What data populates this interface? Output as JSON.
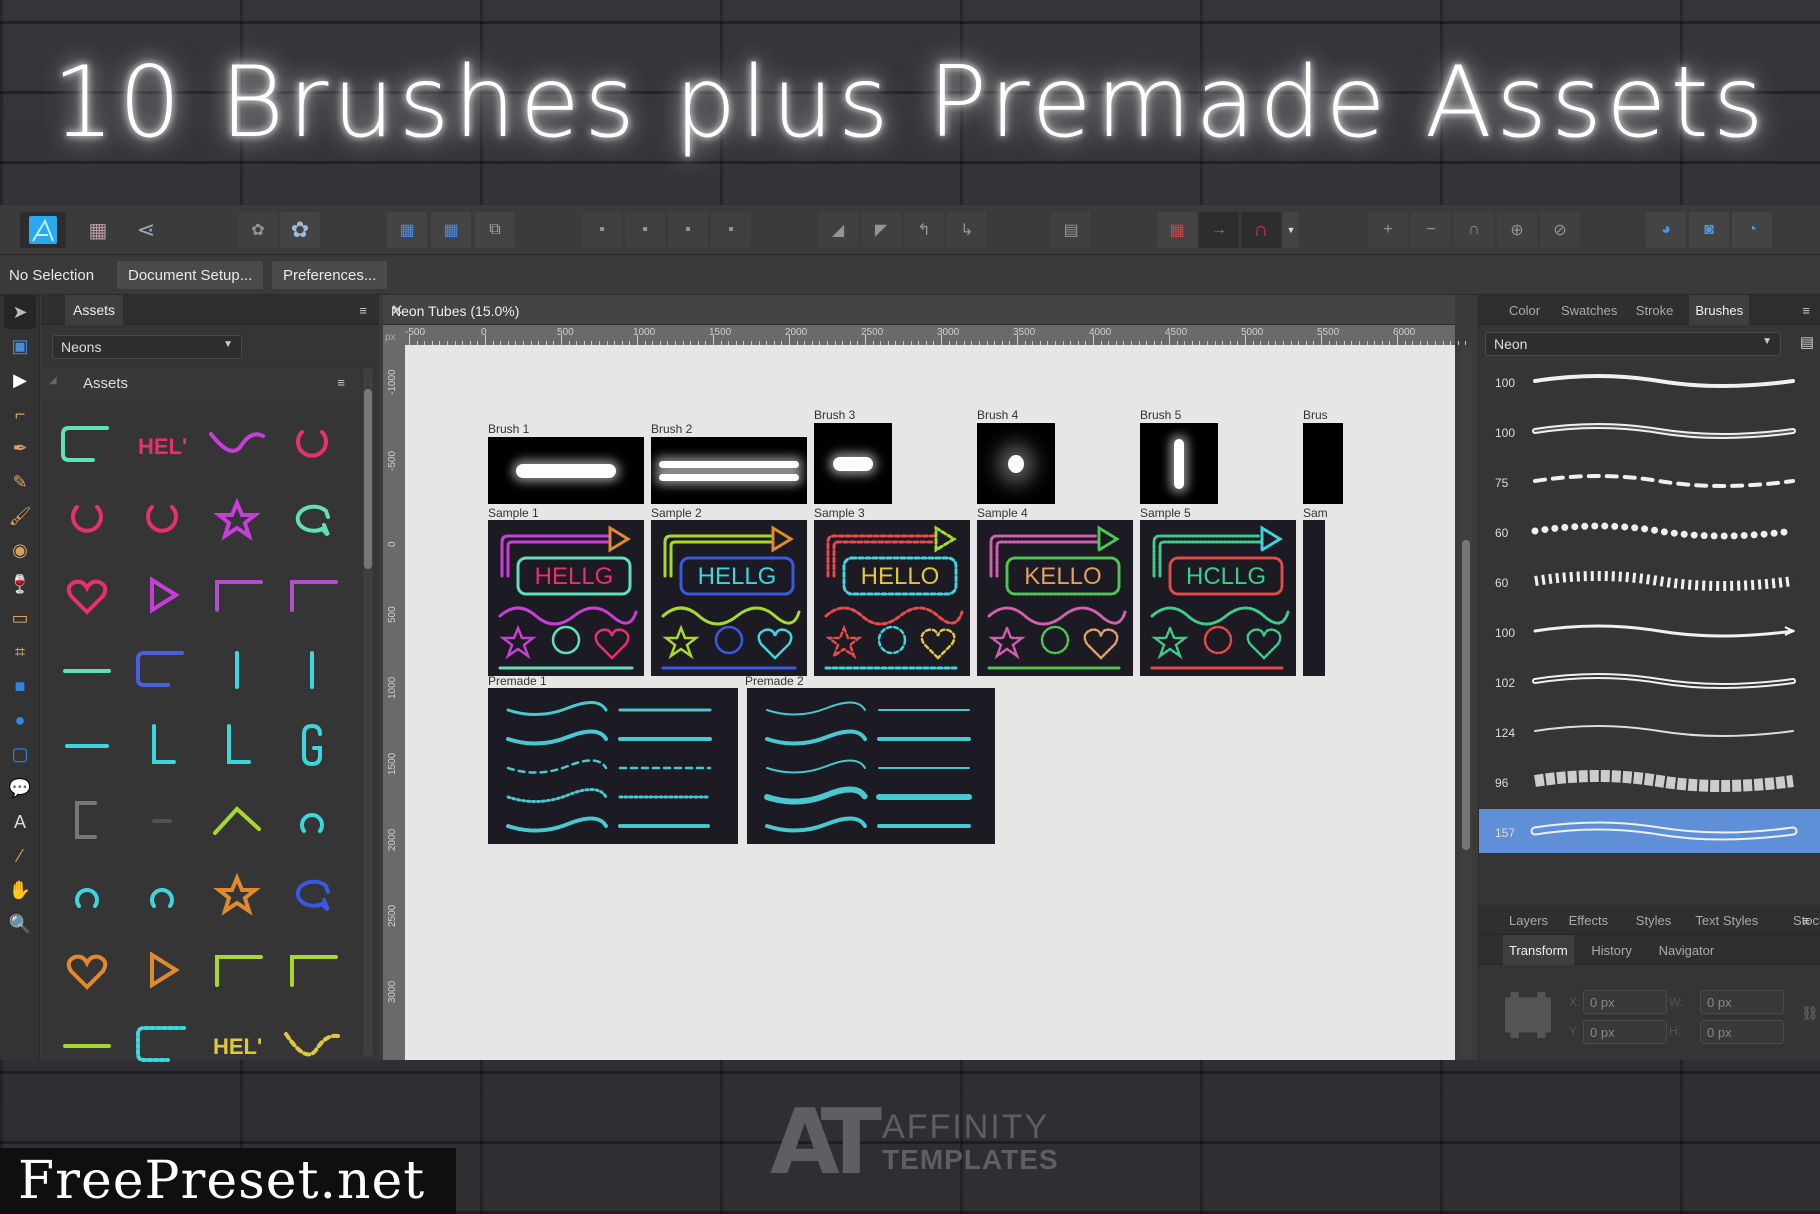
{
  "banner": {
    "title": "10 Brushes plus Premade Assets"
  },
  "toolbar": {
    "persona_icon": "affinity-designer-icon",
    "buttons": [
      "grid-persona-icon",
      "share-icon",
      "boolean-disabled-icon",
      "no-fill-icon",
      "select-grid-icon",
      "select-grid-alt-icon",
      "transform-origin-icon",
      "arrange-back-icon",
      "arrange-backward-icon",
      "arrange-forward-icon",
      "arrange-front-icon",
      "align-icon",
      "flip-h-icon",
      "flip-v-icon",
      "rotate-left-icon",
      "rotate-right-icon",
      "insert-icon",
      "snapping-grid-icon",
      "snapping-arrow-icon",
      "snapping-magnet-icon",
      "add-icon",
      "subtract-icon",
      "intersect-icon",
      "xor-icon",
      "divide-icon",
      "boolean-add-icon",
      "boolean-subtract-icon",
      "boolean-intersect-icon"
    ]
  },
  "context": {
    "selection": "No Selection",
    "document_setup": "Document Setup...",
    "preferences": "Preferences..."
  },
  "tools": [
    "move-tool",
    "artboard-tool",
    "node-tool",
    "corner-tool",
    "pen-tool",
    "pencil-tool",
    "vector-brush-tool",
    "fill-tool",
    "transparency-tool",
    "place-image-tool",
    "crop-tool",
    "rectangle-tool",
    "ellipse-tool",
    "rounded-rect-tool",
    "callout-tool",
    "text-tool",
    "color-picker-tool",
    "view-tool",
    "zoom-tool"
  ],
  "assets_panel": {
    "tab": "Assets",
    "category": "Neons",
    "subcategory": "Assets",
    "items": [
      {
        "shape": "bracket",
        "color": "#5fe0b8"
      },
      {
        "shape": "HEL'",
        "color": "#e8306e"
      },
      {
        "shape": "wave",
        "color": "#c83ed8"
      },
      {
        "shape": "ring",
        "color": "#e8306e"
      },
      {
        "shape": "ring",
        "color": "#e8306e"
      },
      {
        "shape": "ring",
        "color": "#e8306e"
      },
      {
        "shape": "star",
        "color": "#c83ed8"
      },
      {
        "shape": "bubble",
        "color": "#5fe0b8"
      },
      {
        "shape": "heart",
        "color": "#e8306e"
      },
      {
        "shape": "triangle",
        "color": "#c83ed8"
      },
      {
        "shape": "corner",
        "color": "#b24fc8"
      },
      {
        "shape": "corner",
        "color": "#b24fc8"
      },
      {
        "shape": "bar",
        "color": "#5fe0b8"
      },
      {
        "shape": "bracket",
        "color": "#4a60e0"
      },
      {
        "shape": "vline",
        "color": "#3cd6de"
      },
      {
        "shape": "vline",
        "color": "#3cd6de"
      },
      {
        "shape": "bar2",
        "color": "#3cd6de"
      },
      {
        "shape": "L",
        "color": "#3cd6de"
      },
      {
        "shape": "L",
        "color": "#3cd6de"
      },
      {
        "shape": "G",
        "color": "#3cd6de"
      },
      {
        "shape": "C",
        "color": "#777777"
      },
      {
        "shape": "dash",
        "color": "#666666"
      },
      {
        "shape": "arch",
        "color": "#a8d82e"
      },
      {
        "shape": "horseshoe",
        "color": "#3cd6de"
      },
      {
        "shape": "horseshoe",
        "color": "#3cd6de"
      },
      {
        "shape": "horseshoe",
        "color": "#3cd6de"
      },
      {
        "shape": "star",
        "color": "#e08a2e"
      },
      {
        "shape": "bubble",
        "color": "#3a58e0"
      },
      {
        "shape": "heart",
        "color": "#e08a2e"
      },
      {
        "shape": "triangle",
        "color": "#e08a2e"
      },
      {
        "shape": "corner",
        "color": "#a8d82e"
      },
      {
        "shape": "corner",
        "color": "#a8d82e"
      },
      {
        "shape": "bar",
        "color": "#a8d82e"
      },
      {
        "shape": "dashed-bracket",
        "color": "#3cd6de"
      },
      {
        "shape": "HEL'",
        "color": "#e0c83a"
      },
      {
        "shape": "dashed-wave",
        "color": "#e0c83a"
      }
    ]
  },
  "document": {
    "title": "Neon Tubes (15.0%)",
    "ruler_unit": "px",
    "h_ruler_ticks": [
      "-500",
      "0",
      "500",
      "1000",
      "1500",
      "2000",
      "2500",
      "3000",
      "3500",
      "4000",
      "4500",
      "5000",
      "5500",
      "6000"
    ],
    "v_ruler_ticks": [
      "-1000",
      "-500",
      "0",
      "500",
      "1000",
      "1500",
      "2000",
      "2500",
      "3000"
    ],
    "artboards": {
      "brushes": [
        "Brush 1",
        "Brush 2",
        "Brush 3",
        "Brush 4",
        "Brush 5",
        "Brus"
      ],
      "samples": [
        "Sample 1",
        "Sample 2",
        "Sample 3",
        "Sample 4",
        "Sample 5",
        "Sam"
      ],
      "premades": [
        "Premade 1",
        "Premade 2"
      ]
    },
    "sample_text": [
      "HELLG",
      "HELLG",
      "HELLO",
      "KELLO",
      "HCLLG"
    ],
    "sample_colors": [
      {
        "frame": "#c83ed8",
        "box": "#5fe0b8",
        "text": "#e8306e",
        "accent": "#e08a2e"
      },
      {
        "frame": "#a8d82e",
        "box": "#3a58e0",
        "text": "#3cd6de",
        "accent": "#e08a2e"
      },
      {
        "frame": "#e84a4a",
        "box": "#3cd6de",
        "text": "#e0c83a",
        "accent": "#a8d82e"
      },
      {
        "frame": "#d060b0",
        "box": "#4ac850",
        "text": "#e0a060",
        "accent": "#4ac850"
      },
      {
        "frame": "#3ccc8c",
        "box": "#e84a4a",
        "text": "#3ccc8c",
        "accent": "#3cd6de"
      }
    ]
  },
  "right_panel": {
    "tabs": [
      "Color",
      "Swatches",
      "Stroke",
      "Brushes"
    ],
    "active_tab": "Brushes",
    "category": "Neon",
    "brushes": [
      {
        "size": "100",
        "style": "solid"
      },
      {
        "size": "100",
        "style": "double"
      },
      {
        "size": "75",
        "style": "dashed"
      },
      {
        "size": "60",
        "style": "dots"
      },
      {
        "size": "60",
        "style": "bars"
      },
      {
        "size": "100",
        "style": "arrow"
      },
      {
        "size": "102",
        "style": "double-arrow"
      },
      {
        "size": "124",
        "style": "taper"
      },
      {
        "size": "96",
        "style": "blocks"
      },
      {
        "size": "157",
        "style": "outline",
        "selected": true
      }
    ],
    "lower_tabs": [
      "Layers",
      "Effects",
      "Styles",
      "Text Styles",
      "Stock"
    ],
    "transform_tabs": [
      "Transform",
      "History",
      "Navigator"
    ],
    "transform": {
      "x": "0 px",
      "y": "0 px",
      "w": "0 px",
      "h": "0 px",
      "x_label": "X:",
      "y_label": "Y:",
      "w_label": "W:",
      "h_label": "H:"
    }
  },
  "watermarks": {
    "freepreset": "FreePreset.net",
    "affinity_line1": "AFFINITY",
    "affinity_line2": "TEMPLATES",
    "logo": "AT"
  },
  "accent": "#5f8fd6"
}
